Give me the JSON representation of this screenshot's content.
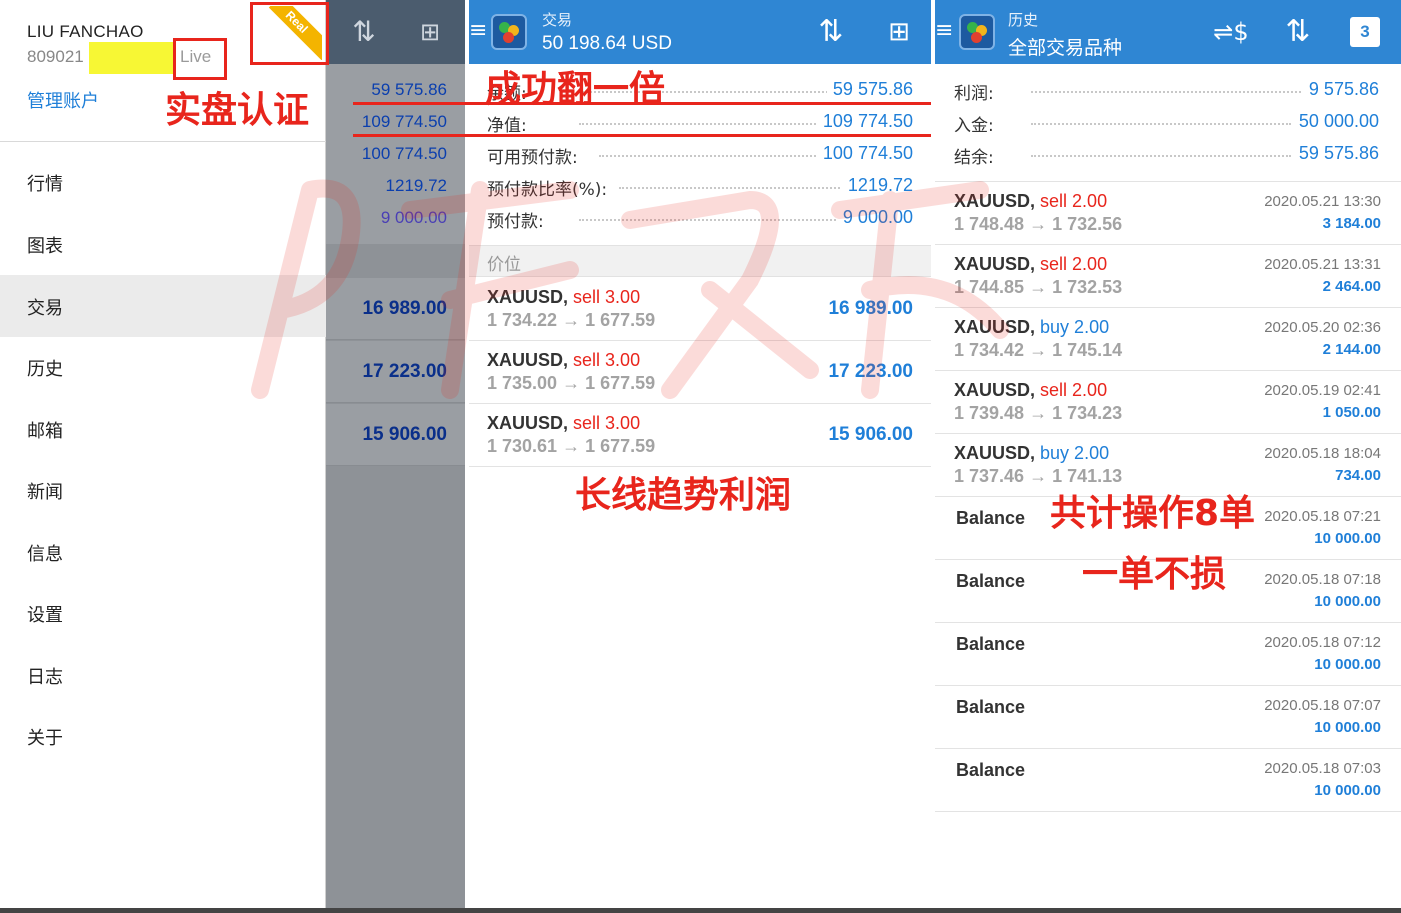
{
  "drawer": {
    "account_name": "LIU FANCHAO",
    "account_number": "809021",
    "account_type": "Live",
    "corner_badge": "Real",
    "manage_label": "管理账户",
    "nav_items": [
      "行情",
      "图表",
      "交易",
      "历史",
      "邮箱",
      "新闻",
      "信息",
      "设置",
      "日志",
      "关于"
    ],
    "active_item": "交易",
    "bg_rows": [
      "59 575.86",
      "109 774.50",
      "100 774.50",
      "1219.72",
      "9 000.00"
    ],
    "bg_positions": [
      "16 989.00",
      "17 223.00",
      "15 906.00"
    ]
  },
  "trade": {
    "header_subtitle": "交易",
    "header_title": "50 198.64 USD",
    "summary": [
      {
        "label": "余额:",
        "value": "59 575.86"
      },
      {
        "label": "净值:",
        "value": "109 774.50"
      },
      {
        "label": "可用预付款:",
        "value": "100 774.50"
      },
      {
        "label": "预付款比率(%):",
        "value": "1219.72"
      },
      {
        "label": "预付款:",
        "value": "9 000.00"
      }
    ],
    "section_label": "价位",
    "positions": [
      {
        "symbol": "XAUUSD,",
        "side": "sell 3.00",
        "open": "1 734.22",
        "current": "1 677.59",
        "profit": "16 989.00"
      },
      {
        "symbol": "XAUUSD,",
        "side": "sell 3.00",
        "open": "1 735.00",
        "current": "1 677.59",
        "profit": "17 223.00"
      },
      {
        "symbol": "XAUUSD,",
        "side": "sell 3.00",
        "open": "1 730.61",
        "current": "1 677.59",
        "profit": "15 906.00"
      }
    ]
  },
  "history": {
    "header_subtitle": "历史",
    "header_title": "全部交易品种",
    "calendar_badge": "3",
    "summary": [
      {
        "label": "利润:",
        "value": "9 575.86"
      },
      {
        "label": "入金:",
        "value": "50 000.00"
      },
      {
        "label": "结余:",
        "value": "59 575.86"
      }
    ],
    "trades": [
      {
        "symbol": "XAUUSD,",
        "side": "sell 2.00",
        "side_type": "sell",
        "open": "1 748.48",
        "close": "1 732.56",
        "time": "2020.05.21 13:30",
        "profit": "3 184.00"
      },
      {
        "symbol": "XAUUSD,",
        "side": "sell 2.00",
        "side_type": "sell",
        "open": "1 744.85",
        "close": "1 732.53",
        "time": "2020.05.21 13:31",
        "profit": "2 464.00"
      },
      {
        "symbol": "XAUUSD,",
        "side": "buy 2.00",
        "side_type": "buy",
        "open": "1 734.42",
        "close": "1 745.14",
        "time": "2020.05.20 02:36",
        "profit": "2 144.00"
      },
      {
        "symbol": "XAUUSD,",
        "side": "sell 2.00",
        "side_type": "sell",
        "open": "1 739.48",
        "close": "1 734.23",
        "time": "2020.05.19 02:41",
        "profit": "1 050.00"
      },
      {
        "symbol": "XAUUSD,",
        "side": "buy 2.00",
        "side_type": "buy",
        "open": "1 737.46",
        "close": "1 741.13",
        "time": "2020.05.18 18:04",
        "profit": "734.00"
      }
    ],
    "balances": [
      {
        "label": "Balance",
        "time": "2020.05.18 07:21",
        "amount": "10 000.00"
      },
      {
        "label": "Balance",
        "time": "2020.05.18 07:18",
        "amount": "10 000.00"
      },
      {
        "label": "Balance",
        "time": "2020.05.18 07:12",
        "amount": "10 000.00"
      },
      {
        "label": "Balance",
        "time": "2020.05.18 07:07",
        "amount": "10 000.00"
      },
      {
        "label": "Balance",
        "time": "2020.05.18 07:03",
        "amount": "10 000.00"
      }
    ]
  },
  "annotations": {
    "live_cert": "实盘认证",
    "doubled": "成功翻一倍",
    "long_trend": "长线趋势利润",
    "total_ops": "共计操作8单",
    "no_loss": "一单不损"
  },
  "colors": {
    "header_blue": "#2f86d3",
    "value_blue": "#1f7fd8",
    "sell_red": "#e8251c",
    "annotation_red": "#e8251c",
    "highlight_yellow": "#f7f734"
  },
  "icons": {
    "sort": "sort-arrows-icon",
    "new_order": "new-order-icon",
    "currency_swap": "currency-exchange-icon",
    "calendar": "calendar-icon",
    "menu": "menu-icon",
    "arrow": "→"
  }
}
